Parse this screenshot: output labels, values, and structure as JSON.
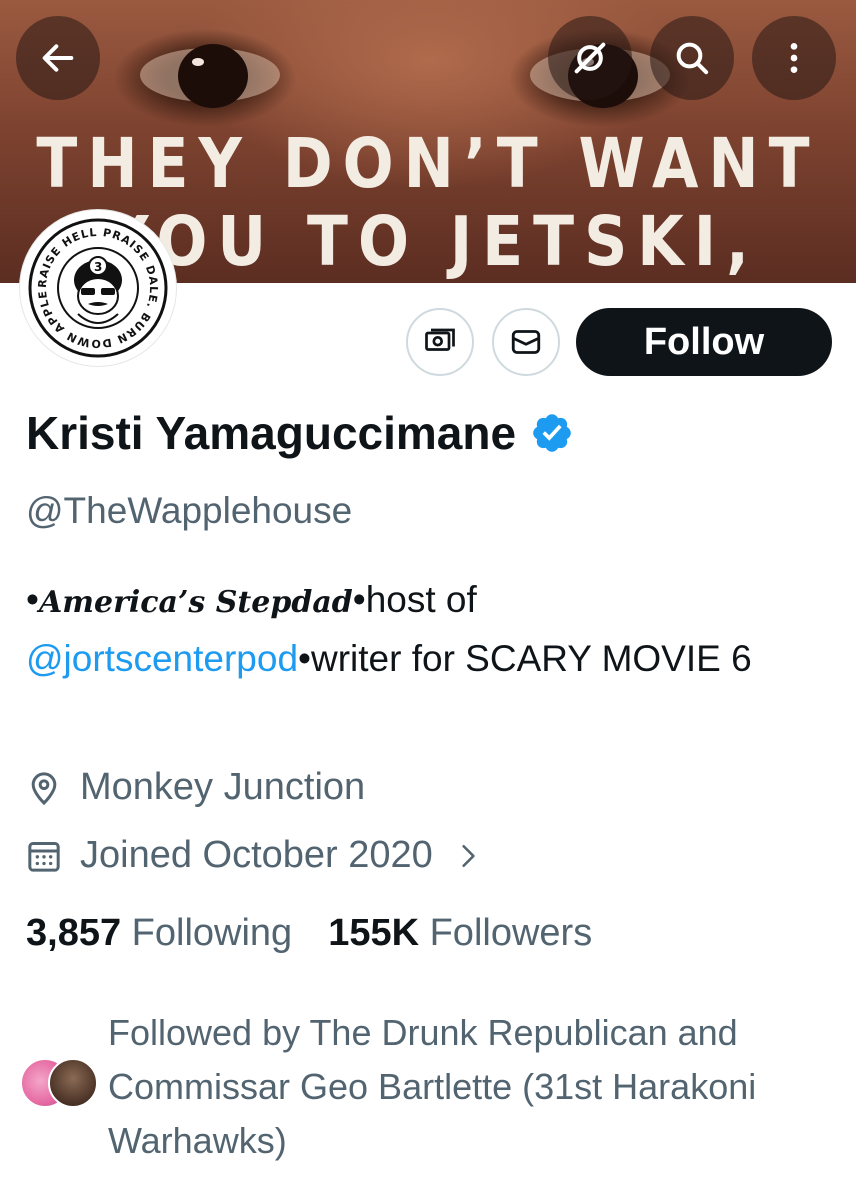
{
  "banner": {
    "line1": "THEY DON’T WANT",
    "line2": "YOU TO JETSKI,"
  },
  "avatar": {
    "ring_text": "RAISE HELL PRAISE DALE. BURN DOWN APPLEBEE'S."
  },
  "top_bar": {
    "icons": [
      "arrow-left-icon",
      "grok-icon",
      "search-icon",
      "more-vertical-icon"
    ]
  },
  "actions": {
    "subscribe_icon": "money-icon",
    "message_icon": "envelope-icon",
    "follow_label": "Follow"
  },
  "profile": {
    "display_name": "Kristi Yamaguccimane",
    "verified": true,
    "handle": "@TheWapplehouse",
    "bio": {
      "prefix": "•",
      "script_text": "America’s Stepdad",
      "middle": "•host of",
      "mention": "@jortscenterpod",
      "suffix": "•writer for SCARY MOVIE 6"
    },
    "location": "Monkey Junction",
    "joined": "Joined October 2020"
  },
  "stats": {
    "following_count": "3,857",
    "following_label": "Following",
    "followers_count": "155K",
    "followers_label": "Followers"
  },
  "followed_by": {
    "text": "Followed by The Drunk Republican and Commissar Geo Bartlette (31st Harakoni Warhawks)"
  },
  "colors": {
    "accent": "#1d9bf0",
    "text_primary": "#0f1419",
    "text_secondary": "#536471",
    "follow_bg": "#0f1419"
  }
}
